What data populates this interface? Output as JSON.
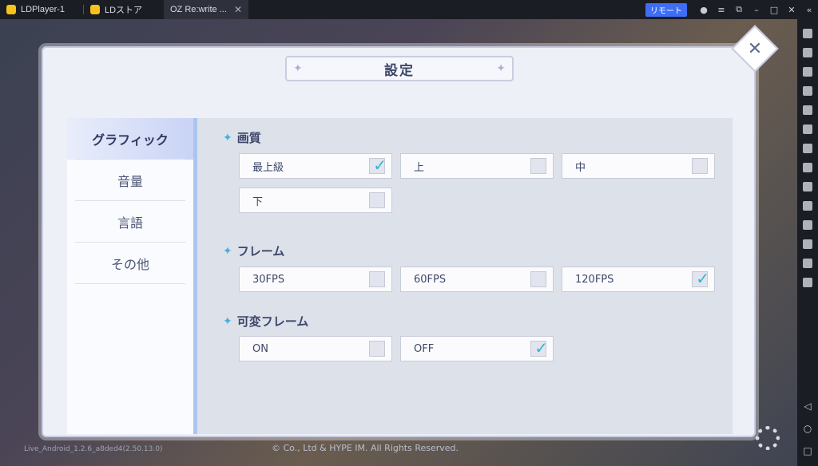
{
  "titlebar": {
    "tabs": [
      {
        "label": "LDPlayer-1",
        "icon": "ldplayer-icon"
      },
      {
        "label": "LDストア",
        "icon": "store-icon"
      },
      {
        "label": "OZ Re:write ...",
        "icon": "game-icon",
        "active": true
      }
    ],
    "remote_label": "リモート",
    "close_glyph": "✕"
  },
  "settings": {
    "title": "設定",
    "menu": [
      {
        "label": "グラフィック",
        "active": true
      },
      {
        "label": "音量"
      },
      {
        "label": "言語"
      },
      {
        "label": "その他"
      }
    ],
    "sections": {
      "quality": {
        "label": "画質",
        "options": [
          {
            "label": "最上級",
            "checked": true
          },
          {
            "label": "上",
            "checked": false
          },
          {
            "label": "中",
            "checked": false
          },
          {
            "label": "下",
            "checked": false
          }
        ]
      },
      "frame": {
        "label": "フレーム",
        "options": [
          {
            "label": "30FPS",
            "checked": false
          },
          {
            "label": "60FPS",
            "checked": false
          },
          {
            "label": "120FPS",
            "checked": true
          }
        ]
      },
      "variable_frame": {
        "label": "可変フレーム",
        "options": [
          {
            "label": "ON",
            "checked": false
          },
          {
            "label": "OFF",
            "checked": true
          }
        ]
      }
    }
  },
  "footer": {
    "version": "Live_Android_1.2.6_a8ded4(2.50.13.0)",
    "copyright": "© Co., Ltd & HYPE IM. All Rights Reserved."
  },
  "colors": {
    "accent": "#2fb8cc",
    "menu_active": "#c9d3f5",
    "panel_bg": "#eef0f7"
  }
}
